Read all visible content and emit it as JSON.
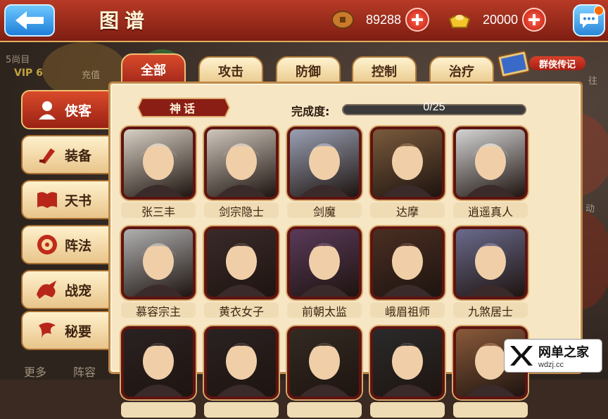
{
  "header": {
    "title": "图谱",
    "currencies": [
      {
        "icon": "copper-coin-icon",
        "value": "89288"
      },
      {
        "icon": "gold-ingot-icon",
        "value": "20000"
      }
    ]
  },
  "background": {
    "left_labels": [
      "5尚目",
      "VIP 6",
      "充值"
    ],
    "right_labels": [
      "往",
      "动"
    ],
    "bottom_labels": [
      "更多",
      "阵容"
    ]
  },
  "tabs": [
    {
      "label": "全部",
      "active": true
    },
    {
      "label": "攻击",
      "active": false
    },
    {
      "label": "防御",
      "active": false
    },
    {
      "label": "控制",
      "active": false
    },
    {
      "label": "治疗",
      "active": false
    }
  ],
  "legend_button": {
    "label": "群侠传记",
    "icon": "book-icon"
  },
  "side_menu": [
    {
      "label": "侠客",
      "icon": "hero-icon",
      "active": true
    },
    {
      "label": "装备",
      "icon": "equipment-icon",
      "active": false
    },
    {
      "label": "天书",
      "icon": "book-icon",
      "active": false
    },
    {
      "label": "阵法",
      "icon": "formation-icon",
      "active": false
    },
    {
      "label": "战宠",
      "icon": "pet-dragon-icon",
      "active": false
    },
    {
      "label": "秘要",
      "icon": "scroll-icon",
      "active": false
    }
  ],
  "category": {
    "label": "神话"
  },
  "progress": {
    "label": "完成度:",
    "text": "0/25",
    "fraction": 0.0
  },
  "heroes": [
    {
      "name": "张三丰",
      "color": "#d8d0c4"
    },
    {
      "name": "剑宗隐士",
      "color": "#cfc6bc"
    },
    {
      "name": "剑魔",
      "color": "#9aa0b4"
    },
    {
      "name": "达摩",
      "color": "#7a5a3c"
    },
    {
      "name": "逍遥真人",
      "color": "#d4d4d4"
    },
    {
      "name": "慕容宗主",
      "color": "#b0b0b0"
    },
    {
      "name": "黄衣女子",
      "color": "#3a2a2a"
    },
    {
      "name": "前朝太监",
      "color": "#5a3a5a"
    },
    {
      "name": "峨眉祖师",
      "color": "#4a2e22"
    },
    {
      "name": "九煞居士",
      "color": "#6a6a8c"
    },
    {
      "name": "",
      "color": "#2a2222"
    },
    {
      "name": "",
      "color": "#2a2222"
    },
    {
      "name": "",
      "color": "#332a22"
    },
    {
      "name": "",
      "color": "#2a2a2a"
    },
    {
      "name": "",
      "color": "#8a5a3a"
    }
  ],
  "watermark": {
    "main": "网单之家",
    "sub": "wdzj.cc"
  },
  "colors": {
    "accent_red": "#b83a26",
    "panel_bg": "#f6e6c4",
    "frame": "#5e1410"
  }
}
